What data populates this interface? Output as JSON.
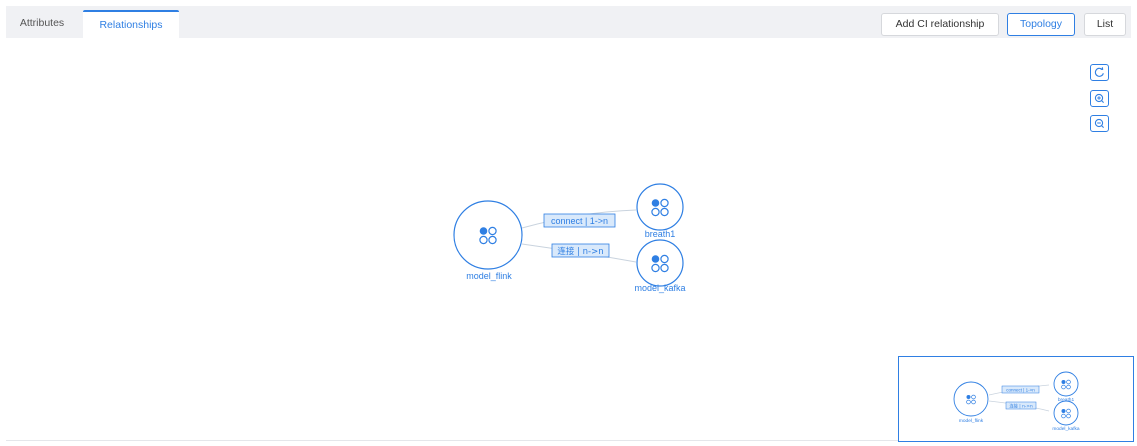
{
  "tabs": {
    "attributes": "Attributes",
    "relationships": "Relationships"
  },
  "toolbar": {
    "add_ci_relationship": "Add CI relationship",
    "topology": "Topology",
    "list": "List"
  },
  "zoom_controls": [
    "refresh-icon",
    "zoom-in-icon",
    "zoom-out-icon"
  ],
  "graph": {
    "nodes": {
      "model_flink": "model_flink",
      "breath1": "breath1",
      "model_kafka": "model_kafka"
    },
    "edges": {
      "connect": "connect | 1->n",
      "lianjie": "连接 | n->n"
    }
  },
  "colors": {
    "accent": "#2f7fe3",
    "edge_label_bg": "#d9e9fb",
    "edge_line": "#c9d3de"
  }
}
